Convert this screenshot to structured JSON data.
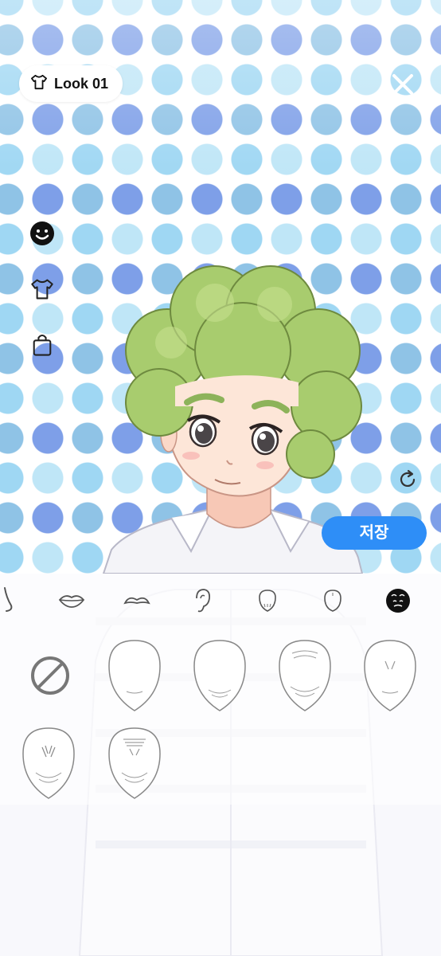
{
  "header": {
    "look_label": "Look 01",
    "look_icon": "tshirt-icon",
    "close_icon": "close-icon"
  },
  "side_tools": [
    {
      "name": "face-tool",
      "icon": "smiley-icon",
      "selected": true
    },
    {
      "name": "clothes-tool",
      "icon": "tshirt-icon",
      "selected": false
    },
    {
      "name": "shop-tool",
      "icon": "shopping-bag-icon",
      "selected": false
    }
  ],
  "actions": {
    "save_label": "저장",
    "reset_icon": "refresh-icon"
  },
  "categories": [
    {
      "name": "nose",
      "icon": "nose-icon",
      "selected": false
    },
    {
      "name": "lips",
      "icon": "lips-icon",
      "selected": false
    },
    {
      "name": "mustache",
      "icon": "mustache-icon",
      "selected": false
    },
    {
      "name": "ear",
      "icon": "ear-icon",
      "selected": false
    },
    {
      "name": "face-shape",
      "icon": "face-outline-icon",
      "selected": false
    },
    {
      "name": "head",
      "icon": "head-outline-icon",
      "selected": false
    },
    {
      "name": "wrinkles",
      "icon": "wrinkle-face-icon",
      "selected": true
    }
  ],
  "options": [
    {
      "name": "none",
      "icon": "no-symbol-icon"
    },
    {
      "name": "face-1",
      "icon": "face-wrinkle-1-icon"
    },
    {
      "name": "face-2",
      "icon": "face-wrinkle-2-icon"
    },
    {
      "name": "face-3",
      "icon": "face-wrinkle-3-icon"
    },
    {
      "name": "face-4",
      "icon": "face-wrinkle-4-icon"
    },
    {
      "name": "face-5",
      "icon": "face-wrinkle-5-icon"
    },
    {
      "name": "face-6",
      "icon": "face-wrinkle-6-icon"
    }
  ],
  "colors": {
    "accent": "#2e8ef7",
    "hair": "#a8cc6e",
    "dot_blue": "#7e9fe8",
    "dot_cyan": "#9fd7f3"
  }
}
